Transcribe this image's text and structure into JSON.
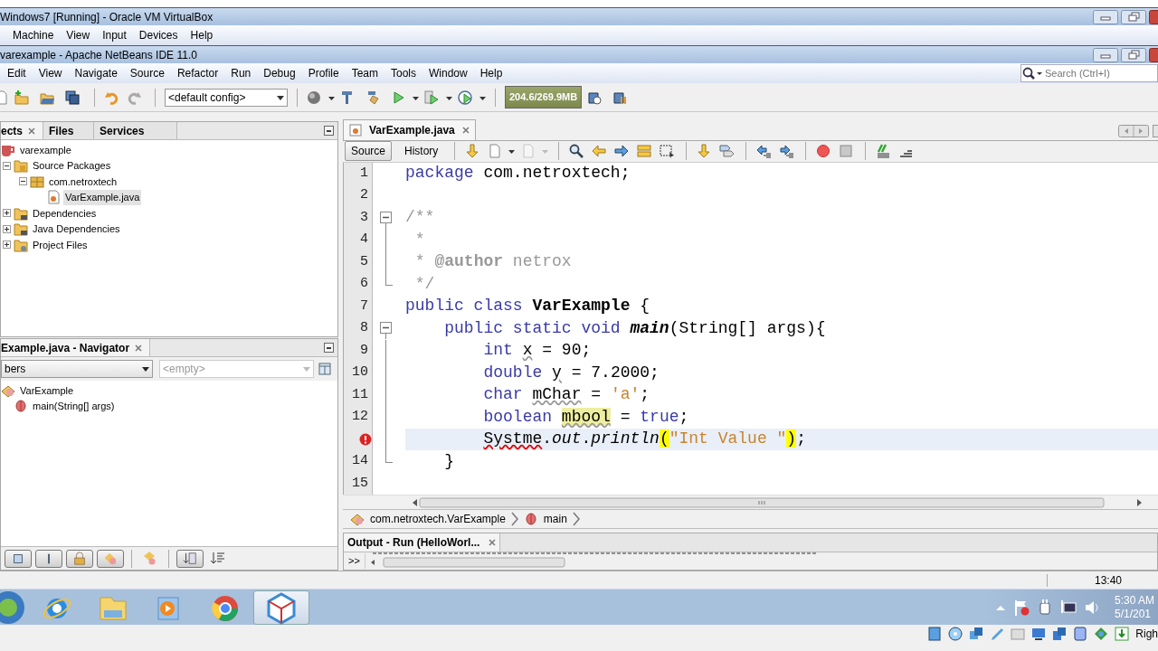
{
  "vbox": {
    "title": "Windows7 [Running] - Oracle VM VirtualBox",
    "menu": [
      "Machine",
      "View",
      "Input",
      "Devices",
      "Help"
    ]
  },
  "ide": {
    "title": "varexample - Apache NetBeans IDE 11.0",
    "menu": [
      "Edit",
      "View",
      "Navigate",
      "Source",
      "Refactor",
      "Run",
      "Debug",
      "Profile",
      "Team",
      "Tools",
      "Window",
      "Help"
    ],
    "search": {
      "placeholder": "Search (Ctrl+I)"
    },
    "config": "<default config>",
    "memory": "204.6/269.9MB"
  },
  "projects": {
    "tabs": [
      {
        "label": "ects",
        "selected": true
      },
      {
        "label": "Files",
        "selected": false
      },
      {
        "label": "Services",
        "selected": false
      }
    ],
    "tree": [
      {
        "label": "varexample",
        "kind": "project",
        "selected": false,
        "children": [
          {
            "label": "Source Packages",
            "kind": "source-folder",
            "expanded": true,
            "selected": false,
            "children": [
              {
                "label": "com.netroxtech",
                "kind": "package",
                "expanded": true,
                "selected": false,
                "children": [
                  {
                    "label": "VarExample.java",
                    "kind": "java-file",
                    "selected": true
                  }
                ]
              }
            ]
          },
          {
            "label": "Dependencies",
            "kind": "library-folder",
            "expanded": false,
            "selected": false
          },
          {
            "label": "Java Dependencies",
            "kind": "library-folder",
            "expanded": false,
            "selected": false
          },
          {
            "label": "Project Files",
            "kind": "settings-folder",
            "expanded": false,
            "selected": false
          }
        ]
      }
    ]
  },
  "navigator": {
    "title": "Example.java - Navigator",
    "filter": "bers",
    "scope": {
      "text": "<empty>",
      "disabled": true
    },
    "tree": [
      {
        "label": "VarExample",
        "kind": "class",
        "selected": false,
        "children": [
          {
            "label": "main(String[] args)",
            "kind": "method",
            "selected": false
          }
        ]
      }
    ],
    "toolbar": [
      {
        "kind": "square",
        "selected": true
      },
      {
        "kind": "bar",
        "selected": true
      },
      {
        "kind": "lock",
        "selected": true
      },
      {
        "kind": "shapes",
        "selected": true
      },
      {
        "kind": "inherit",
        "selected": false
      },
      {
        "kind": "sort-az",
        "selected": true
      },
      {
        "kind": "sort-source",
        "selected": false
      }
    ]
  },
  "editor": {
    "tabs": [
      {
        "label": "VarExample.java",
        "selected": true
      }
    ],
    "views": [
      {
        "label": "Source",
        "selected": true
      },
      {
        "label": "History",
        "selected": false
      }
    ],
    "lines": [
      {
        "number": "1",
        "error": false,
        "current": false,
        "tokens": [
          {
            "kind": "keyword",
            "text": "package"
          },
          {
            "kind": "plain",
            "text": " com.netroxtech;"
          }
        ]
      },
      {
        "number": "2",
        "error": false,
        "current": false
      },
      {
        "number": "3",
        "error": false,
        "current": false,
        "expanded": true,
        "tokens": [
          {
            "kind": "comment",
            "text": "/**"
          }
        ]
      },
      {
        "number": "4",
        "error": false,
        "current": false,
        "tokens": [
          {
            "kind": "comment",
            "text": " *"
          }
        ]
      },
      {
        "number": "5",
        "error": false,
        "current": false,
        "tokens": [
          {
            "kind": "comment",
            "text": " * "
          },
          {
            "kind": "doctag",
            "text": "@author"
          },
          {
            "kind": "comment",
            "text": " netrox"
          }
        ]
      },
      {
        "number": "6",
        "error": false,
        "current": false,
        "fold_end": true,
        "tokens": [
          {
            "kind": "comment",
            "text": " */"
          }
        ]
      },
      {
        "number": "7",
        "error": false,
        "current": false,
        "tokens": [
          {
            "kind": "keyword",
            "text": "public class"
          },
          {
            "kind": "classdecl",
            "text": " VarExample"
          },
          {
            "kind": "plain",
            "text": " {"
          }
        ]
      },
      {
        "number": "8",
        "error": false,
        "current": false,
        "expanded": true,
        "tokens": [
          {
            "kind": "keyword",
            "text": "    public static void"
          },
          {
            "kind": "methoddecl",
            "text": " main"
          },
          {
            "kind": "plain",
            "text": "(String[] args){"
          }
        ]
      },
      {
        "number": "9",
        "error": false,
        "current": false,
        "tokens": [
          {
            "kind": "keyword",
            "text": "        int"
          },
          {
            "kind": "unused",
            "text": " x"
          },
          {
            "kind": "plain",
            "text": " = 90;"
          }
        ]
      },
      {
        "number": "10",
        "error": false,
        "current": false,
        "tokens": [
          {
            "kind": "keyword",
            "text": "        double"
          },
          {
            "kind": "unused",
            "text": " y"
          },
          {
            "kind": "plain",
            "text": " = 7.2000;"
          }
        ]
      },
      {
        "number": "11",
        "error": false,
        "current": false,
        "tokens": [
          {
            "kind": "keyword",
            "text": "        char"
          },
          {
            "kind": "unused",
            "text": " mChar"
          },
          {
            "kind": "plain",
            "text": " = "
          },
          {
            "kind": "string",
            "text": "'a'"
          },
          {
            "kind": "plain",
            "text": ";"
          }
        ]
      },
      {
        "number": "12",
        "error": false,
        "current": false,
        "tokens": [
          {
            "kind": "keyword",
            "text": "        boolean"
          },
          {
            "kind": "occurrence",
            "text": " mbool"
          },
          {
            "kind": "plain",
            "text": " = "
          },
          {
            "kind": "keyword",
            "text": "true"
          },
          {
            "kind": "plain",
            "text": ";"
          }
        ]
      },
      {
        "error": true,
        "current": true,
        "tokens": [
          {
            "kind": "error",
            "text": "        Systme"
          },
          {
            "kind": "plain",
            "text": "."
          },
          {
            "kind": "static",
            "text": "out"
          },
          {
            "kind": "plain",
            "text": "."
          },
          {
            "kind": "static",
            "text": "println"
          },
          {
            "kind": "brace",
            "text": "("
          },
          {
            "kind": "string",
            "text": "\"Int Value \""
          },
          {
            "kind": "brace",
            "text": ")"
          },
          {
            "kind": "plain",
            "text": ";"
          }
        ]
      },
      {
        "number": "14",
        "error": false,
        "current": false,
        "fold_end": true,
        "tokens": [
          {
            "kind": "plain",
            "text": "    }"
          }
        ]
      },
      {
        "number": "15",
        "error": false,
        "current": false
      }
    ],
    "breadcrumb": [
      {
        "label": "com.netroxtech.VarExample",
        "kind": "class"
      },
      {
        "label": "main",
        "kind": "method"
      }
    ]
  },
  "output": {
    "tab": "Output - Run (HelloWorl...",
    "expander": ">>"
  },
  "status_bar": {
    "position": "13:40"
  },
  "taskbar": {
    "items": [
      {
        "kind": "start",
        "selected": false
      },
      {
        "kind": "browser-e",
        "selected": false
      },
      {
        "kind": "folder",
        "selected": false
      },
      {
        "kind": "player",
        "selected": false
      },
      {
        "kind": "browser-ring",
        "selected": false
      },
      {
        "kind": "cube",
        "selected": true
      }
    ],
    "clock": {
      "time": "5:30 AM",
      "date": "5/1/201"
    }
  },
  "vbox_status": {
    "label": "Righ"
  }
}
